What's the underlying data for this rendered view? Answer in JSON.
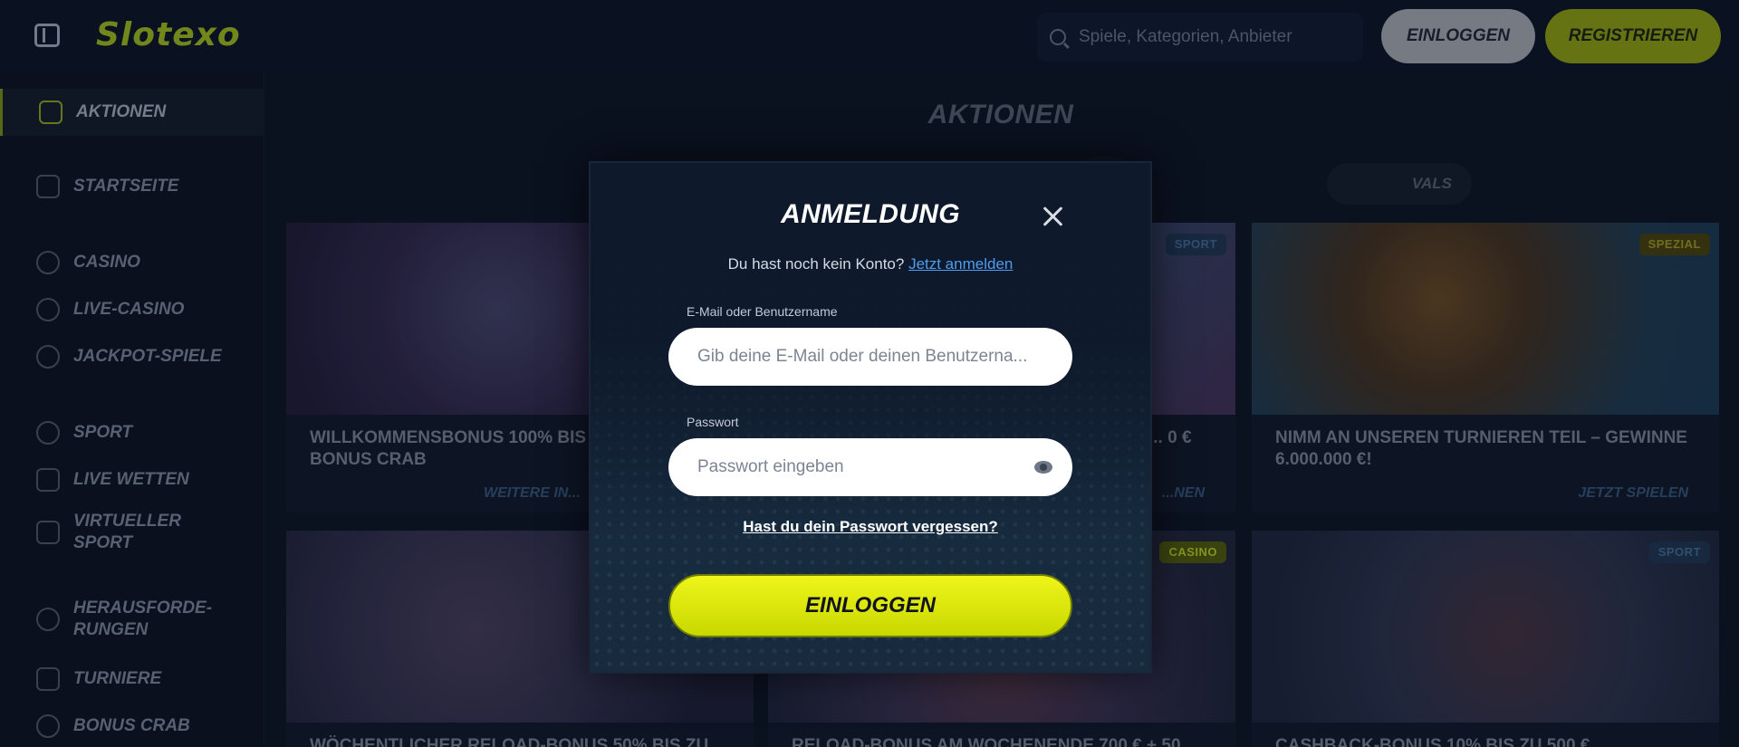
{
  "header": {
    "logo": "Slotexo",
    "search_placeholder": "Spiele, Kategorien, Anbieter",
    "login_label": "EINLOGGEN",
    "register_label": "REGISTRIEREN"
  },
  "sidebar": {
    "items": [
      {
        "label": "AKTIONEN",
        "icon": "gift-icon",
        "active": true
      },
      {
        "label": "STARTSEITE",
        "icon": "home-icon"
      },
      {
        "label": "CASINO",
        "icon": "casino-chip-icon"
      },
      {
        "label": "LIVE-CASINO",
        "icon": "spade-icon"
      },
      {
        "label": "JACKPOT-SPIELE",
        "icon": "question-icon"
      },
      {
        "label": "SPORT",
        "icon": "football-icon"
      },
      {
        "label": "LIVE WETTEN",
        "icon": "play-icon"
      },
      {
        "label": "VIRTUELLER SPORT",
        "icon": "gamepad-icon"
      },
      {
        "label": "HERAUSFORDE-RUNGEN",
        "icon": "medal-icon"
      },
      {
        "label": "TURNIERE",
        "icon": "trophy-icon"
      },
      {
        "label": "BONUS CRAB",
        "icon": "bonus-icon"
      }
    ]
  },
  "main": {
    "title": "AKTIONEN",
    "filter_label": "VALS",
    "cards": [
      {
        "title": "WILLKOMMENSBONUS 100% BIS Z... + 200 FS + 1 BONUS CRAB",
        "link": "WEITERE IN...",
        "badge": ""
      },
      {
        "title": "... 0 €",
        "link": "...NEN",
        "badge": "SPORT"
      },
      {
        "title": "NIMM AN UNSEREN TURNIEREN TEIL – GEWINNE 6.000.000 €!",
        "link": "JETZT SPIELEN",
        "badge": "SPEZIAL"
      },
      {
        "title": "WÖCHENTLICHER RELOAD-BONUS 50% BIS ZU...",
        "link": "",
        "badge": ""
      },
      {
        "title": "RELOAD-BONUS AM WOCHENENDE 700 € + 50...",
        "link": "",
        "badge": "CASINO"
      },
      {
        "title": "CASHBACK-BONUS 10% BIS ZU 500 €",
        "link": "",
        "badge": "SPORT"
      }
    ]
  },
  "modal": {
    "title": "ANMELDUNG",
    "no_account_text": "Du hast noch kein Konto?",
    "register_link": "Jetzt anmelden",
    "email_label": "E-Mail oder Benutzername",
    "email_placeholder": "Gib deine E-Mail oder deinen Benutzerna...",
    "password_label": "Passwort",
    "password_placeholder": "Passwort eingeben",
    "forgot_password": "Hast du dein Passwort vergessen?",
    "login_button": "EINLOGGEN"
  },
  "colors": {
    "accent": "#d9e80a",
    "link": "#4f9cf0",
    "background": "#0c1322"
  }
}
